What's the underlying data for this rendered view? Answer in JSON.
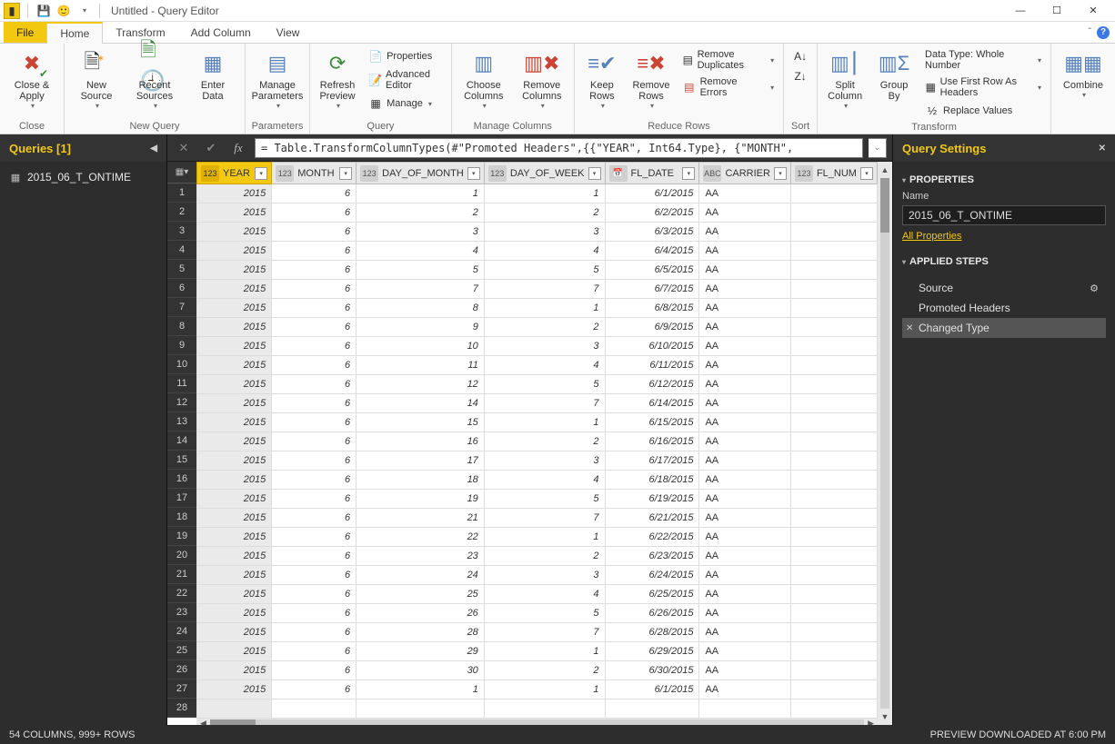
{
  "title": "Untitled - Query Editor",
  "tabs": {
    "file": "File",
    "home": "Home",
    "transform": "Transform",
    "addcolumn": "Add Column",
    "view": "View"
  },
  "ribbon": {
    "close": {
      "close_apply": "Close &\nApply",
      "group": "Close"
    },
    "newquery": {
      "new_source": "New\nSource",
      "recent_sources": "Recent\nSources",
      "enter_data": "Enter\nData",
      "group": "New Query"
    },
    "parameters": {
      "manage_params": "Manage\nParameters",
      "group": "Parameters"
    },
    "query": {
      "refresh": "Refresh\nPreview",
      "properties": "Properties",
      "adv_editor": "Advanced Editor",
      "manage": "Manage",
      "group": "Query"
    },
    "managecols": {
      "choose": "Choose\nColumns",
      "remove": "Remove\nColumns",
      "group": "Manage Columns"
    },
    "reducerows": {
      "keep": "Keep\nRows",
      "removerows": "Remove\nRows",
      "removedup": "Remove Duplicates",
      "removeerr": "Remove Errors",
      "group": "Reduce Rows"
    },
    "sort": {
      "group": "Sort"
    },
    "transform": {
      "split": "Split\nColumn",
      "groupby": "Group\nBy",
      "datatype": "Data Type: Whole Number",
      "firstrow": "Use First Row As Headers",
      "replace": "Replace Values",
      "group": "Transform"
    },
    "combine": {
      "combine": "Combine",
      "group": ""
    }
  },
  "queries": {
    "title": "Queries [1]",
    "items": [
      "2015_06_T_ONTIME"
    ]
  },
  "formula": "= Table.TransformColumnTypes(#\"Promoted Headers\",{{\"YEAR\", Int64.Type}, {\"MONTH\",",
  "columns": [
    {
      "name": "YEAR",
      "type": "123",
      "active": true
    },
    {
      "name": "MONTH",
      "type": "123"
    },
    {
      "name": "DAY_OF_MONTH",
      "type": "123"
    },
    {
      "name": "DAY_OF_WEEK",
      "type": "123"
    },
    {
      "name": "FL_DATE",
      "type": "cal"
    },
    {
      "name": "CARRIER",
      "type": "ABC"
    },
    {
      "name": "FL_NUM",
      "type": "123"
    }
  ],
  "rows": [
    [
      2015,
      6,
      1,
      1,
      "6/1/2015",
      "AA"
    ],
    [
      2015,
      6,
      2,
      2,
      "6/2/2015",
      "AA"
    ],
    [
      2015,
      6,
      3,
      3,
      "6/3/2015",
      "AA"
    ],
    [
      2015,
      6,
      4,
      4,
      "6/4/2015",
      "AA"
    ],
    [
      2015,
      6,
      5,
      5,
      "6/5/2015",
      "AA"
    ],
    [
      2015,
      6,
      7,
      7,
      "6/7/2015",
      "AA"
    ],
    [
      2015,
      6,
      8,
      1,
      "6/8/2015",
      "AA"
    ],
    [
      2015,
      6,
      9,
      2,
      "6/9/2015",
      "AA"
    ],
    [
      2015,
      6,
      10,
      3,
      "6/10/2015",
      "AA"
    ],
    [
      2015,
      6,
      11,
      4,
      "6/11/2015",
      "AA"
    ],
    [
      2015,
      6,
      12,
      5,
      "6/12/2015",
      "AA"
    ],
    [
      2015,
      6,
      14,
      7,
      "6/14/2015",
      "AA"
    ],
    [
      2015,
      6,
      15,
      1,
      "6/15/2015",
      "AA"
    ],
    [
      2015,
      6,
      16,
      2,
      "6/16/2015",
      "AA"
    ],
    [
      2015,
      6,
      17,
      3,
      "6/17/2015",
      "AA"
    ],
    [
      2015,
      6,
      18,
      4,
      "6/18/2015",
      "AA"
    ],
    [
      2015,
      6,
      19,
      5,
      "6/19/2015",
      "AA"
    ],
    [
      2015,
      6,
      21,
      7,
      "6/21/2015",
      "AA"
    ],
    [
      2015,
      6,
      22,
      1,
      "6/22/2015",
      "AA"
    ],
    [
      2015,
      6,
      23,
      2,
      "6/23/2015",
      "AA"
    ],
    [
      2015,
      6,
      24,
      3,
      "6/24/2015",
      "AA"
    ],
    [
      2015,
      6,
      25,
      4,
      "6/25/2015",
      "AA"
    ],
    [
      2015,
      6,
      26,
      5,
      "6/26/2015",
      "AA"
    ],
    [
      2015,
      6,
      28,
      7,
      "6/28/2015",
      "AA"
    ],
    [
      2015,
      6,
      29,
      1,
      "6/29/2015",
      "AA"
    ],
    [
      2015,
      6,
      30,
      2,
      "6/30/2015",
      "AA"
    ],
    [
      2015,
      6,
      1,
      1,
      "6/1/2015",
      "AA"
    ],
    [
      "",
      "",
      "",
      "",
      "",
      ""
    ]
  ],
  "settings": {
    "title": "Query Settings",
    "properties": "PROPERTIES",
    "name_label": "Name",
    "name_value": "2015_06_T_ONTIME",
    "all_props": "All Properties",
    "applied_steps": "APPLIED STEPS",
    "steps": [
      {
        "label": "Source",
        "gear": true,
        "sel": false
      },
      {
        "label": "Promoted Headers",
        "gear": false,
        "sel": false
      },
      {
        "label": "Changed Type",
        "gear": false,
        "sel": true
      }
    ]
  },
  "status": {
    "left": "54 COLUMNS, 999+ ROWS",
    "right": "PREVIEW DOWNLOADED AT 6:00 PM"
  }
}
